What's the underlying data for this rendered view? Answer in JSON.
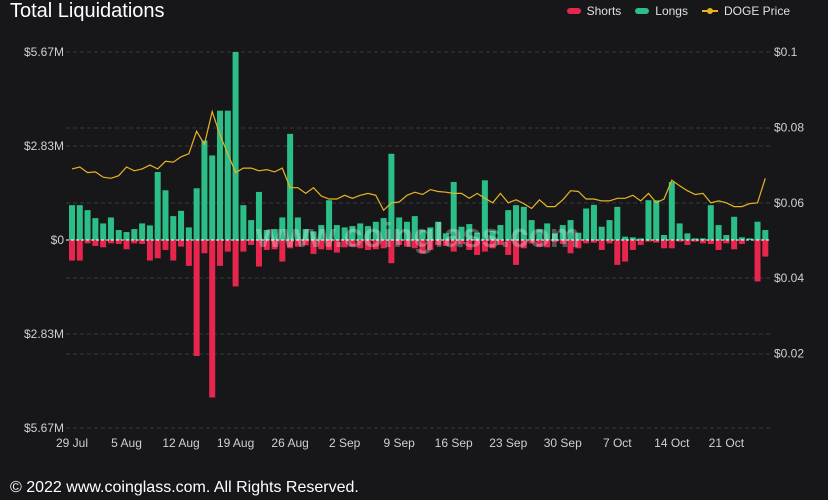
{
  "title": "Total Liquidations",
  "legend": [
    {
      "name": "Shorts",
      "color": "#e6264d"
    },
    {
      "name": "Longs",
      "color": "#2bbf87"
    },
    {
      "name": "DOGE Price",
      "color": "#e6b422"
    }
  ],
  "watermark": "www.coinglass.com",
  "footer": "© 2022 www.coinglass.com. All Rights Reserved.",
  "chart_data": {
    "type": "bar",
    "title": "Total Liquidations",
    "x_tick_labels": [
      "29 Jul",
      "5 Aug",
      "12 Aug",
      "19 Aug",
      "26 Aug",
      "2 Sep",
      "9 Sep",
      "16 Sep",
      "23 Sep",
      "30 Sep",
      "7 Oct",
      "14 Oct",
      "21 Oct"
    ],
    "x_tick_day_index": [
      0,
      7,
      14,
      21,
      28,
      35,
      42,
      49,
      56,
      63,
      70,
      77,
      84
    ],
    "y_left": {
      "ticks": [
        "$5.67M",
        "$2.83M",
        "$0",
        "$2.83M",
        "$5.67M"
      ],
      "range_musd": [
        -5.67,
        5.67
      ]
    },
    "y_right": {
      "ticks": [
        "$0.1",
        "$0.08",
        "$0.06",
        "$0.04",
        "$0.02"
      ],
      "range_usd": [
        0,
        0.1
      ]
    },
    "grid": true,
    "legend_position": "top-right",
    "start_date": "29 Jul",
    "series": [
      {
        "name": "Longs",
        "unit": "M USD",
        "values": [
          1.05,
          1.05,
          0.9,
          0.66,
          0.5,
          0.68,
          0.3,
          0.24,
          0.33,
          0.5,
          0.44,
          2.05,
          1.5,
          0.72,
          0.88,
          0.38,
          1.56,
          3.0,
          2.55,
          3.9,
          3.9,
          5.67,
          1.05,
          0.6,
          1.45,
          0.3,
          0.33,
          0.68,
          3.2,
          0.68,
          0.33,
          0.26,
          0.45,
          1.2,
          0.45,
          0.38,
          0.42,
          0.5,
          0.42,
          0.55,
          0.66,
          2.6,
          0.68,
          0.55,
          0.72,
          0.3,
          0.38,
          0.55,
          0.2,
          1.75,
          0.4,
          0.48,
          0.22,
          1.8,
          0.28,
          0.45,
          0.9,
          1.05,
          1.0,
          0.6,
          0.32,
          0.5,
          0.2,
          0.45,
          0.6,
          0.22,
          0.95,
          1.06,
          0.4,
          0.6,
          1.0,
          0.1,
          0.08,
          0.05,
          1.2,
          1.2,
          0.15,
          1.75,
          0.5,
          0.2,
          0.05,
          0.05,
          1.05,
          0.45,
          0.15,
          0.7,
          0.08,
          0.05,
          0.55,
          0.3
        ]
      },
      {
        "name": "Shorts",
        "unit": "M USD",
        "values": [
          0.62,
          0.62,
          0.1,
          0.18,
          0.22,
          0.1,
          0.12,
          0.28,
          0.1,
          0.12,
          0.62,
          0.55,
          0.3,
          0.62,
          0.2,
          0.78,
          3.5,
          0.4,
          4.75,
          0.78,
          0.35,
          1.4,
          0.35,
          0.15,
          0.8,
          0.3,
          0.28,
          0.65,
          0.25,
          0.2,
          0.16,
          0.42,
          0.28,
          0.3,
          0.38,
          0.22,
          0.2,
          0.25,
          0.3,
          0.28,
          0.25,
          0.7,
          0.15,
          0.2,
          0.25,
          0.4,
          0.3,
          0.15,
          0.18,
          0.35,
          0.12,
          0.3,
          0.45,
          0.35,
          0.25,
          0.15,
          0.45,
          0.75,
          0.25,
          0.1,
          0.2,
          0.22,
          0.05,
          0.12,
          0.4,
          0.25,
          0.1,
          0.08,
          0.3,
          0.1,
          0.75,
          0.65,
          0.3,
          0.15,
          0.05,
          0.08,
          0.25,
          0.25,
          0.05,
          0.15,
          0.05,
          0.1,
          0.12,
          0.3,
          0.1,
          0.28,
          0.12,
          0.0,
          1.25,
          0.5
        ]
      },
      {
        "name": "DOGE Price",
        "unit": "USD",
        "values": [
          0.069,
          0.0695,
          0.068,
          0.0682,
          0.0668,
          0.0665,
          0.0672,
          0.0695,
          0.0685,
          0.069,
          0.07,
          0.069,
          0.071,
          0.0708,
          0.0722,
          0.073,
          0.079,
          0.0755,
          0.0842,
          0.078,
          0.073,
          0.068,
          0.0692,
          0.0692,
          0.0685,
          0.0688,
          0.0682,
          0.0692,
          0.064,
          0.064,
          0.0625,
          0.064,
          0.0618,
          0.061,
          0.061,
          0.062,
          0.0612,
          0.062,
          0.0625,
          0.062,
          0.058,
          0.06,
          0.0602,
          0.062,
          0.0628,
          0.0622,
          0.0635,
          0.063,
          0.0628,
          0.0625,
          0.0625,
          0.0612,
          0.0625,
          0.0612,
          0.06,
          0.0625,
          0.06,
          0.0608,
          0.0598,
          0.0585,
          0.0608,
          0.059,
          0.059,
          0.0608,
          0.0632,
          0.063,
          0.061,
          0.061,
          0.0605,
          0.0605,
          0.0612,
          0.0612,
          0.062,
          0.0605,
          0.0625,
          0.06,
          0.061,
          0.066,
          0.0645,
          0.0632,
          0.0622,
          0.0625,
          0.06,
          0.0605,
          0.06,
          0.059,
          0.059,
          0.0598,
          0.06,
          0.0665
        ]
      }
    ]
  }
}
